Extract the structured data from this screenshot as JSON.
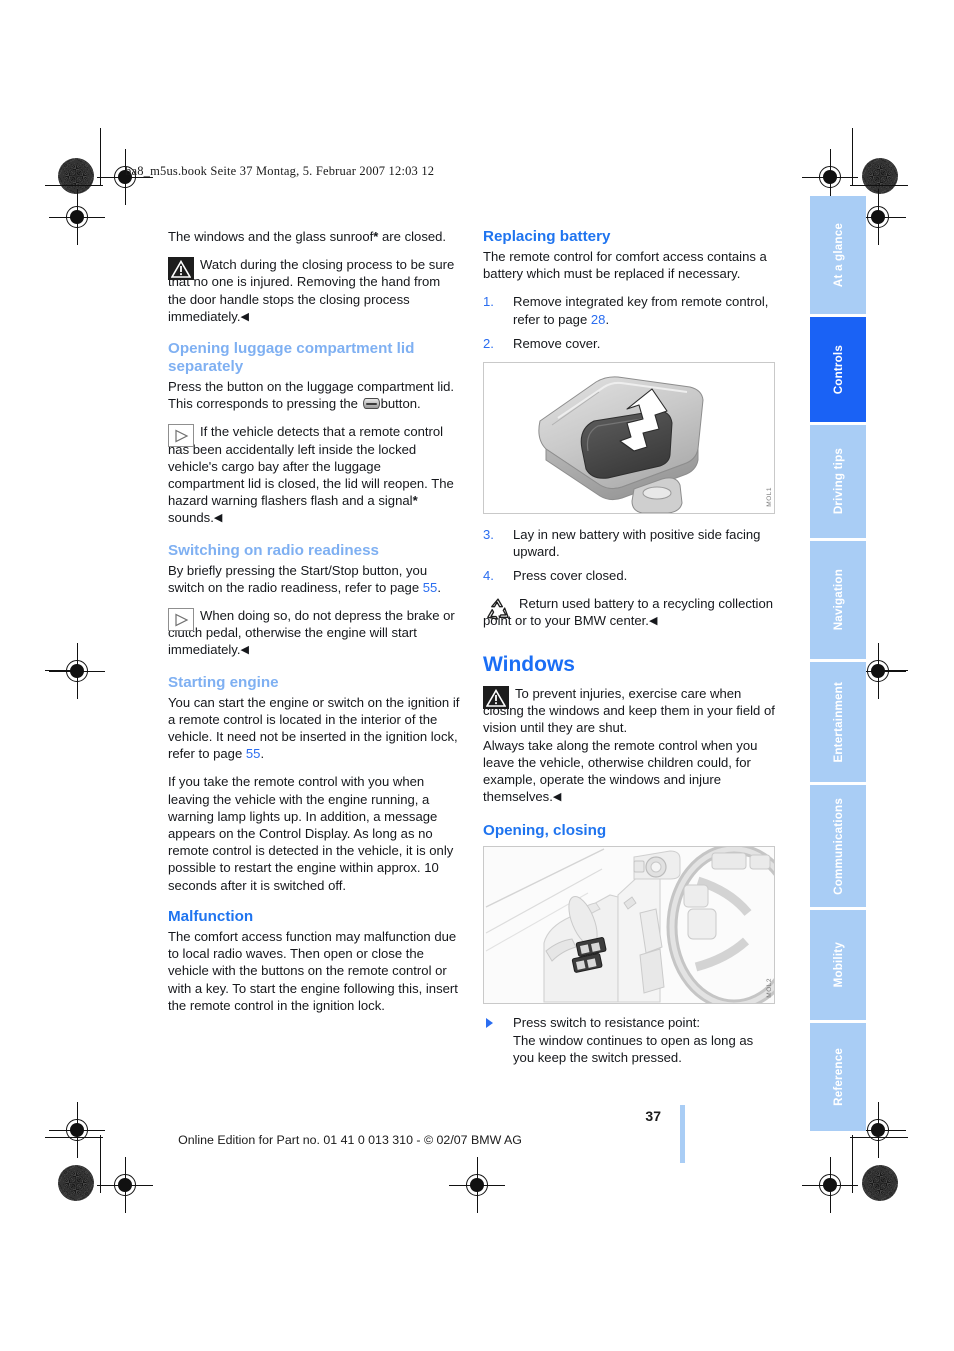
{
  "document": {
    "file_header": "ba8_m5us.book  Seite 37  Montag, 5. Februar 2007  12:03 12",
    "page_number": "37",
    "footer": "Online Edition for Part no. 01 41 0 013 310 - © 02/07 BMW AG"
  },
  "colors": {
    "heading_primary": "#1a6ef5",
    "subheading_light": "#7fb0f2",
    "subheading_dark": "#1f74ef",
    "tab_inactive": "#a9cdf5",
    "tab_active": "#1a62f5",
    "crossref": "#2a6df0",
    "body_text": "#16181c"
  },
  "left_column": {
    "intro": {
      "text": "The windows and the glass sunroof",
      "asterisk": "*",
      "text_tail": " are closed."
    },
    "warning_1": {
      "icon": "warning-triangle-icon",
      "text": "Watch during the closing process to be sure that no one is injured. Removing the hand from the door handle stops the closing process immediately.",
      "end_mark": "◀"
    },
    "section_luggage": {
      "heading": "Opening luggage compartment lid separately",
      "paragraph_a": "Press the button on the luggage compartment lid. This corresponds to pressing the",
      "paragraph_b": "button.",
      "inline_icon": "trunk-release-button-icon",
      "note": {
        "icon": "play-triangle-note-icon",
        "text": "If the vehicle detects that a remote control has been accidentally left inside the locked vehicle's cargo bay after the luggage compartment lid is closed, the lid will reopen. The hazard warning flashers flash and a signal",
        "asterisk": "*",
        "text_tail": " sounds.",
        "end_mark": "◀"
      }
    },
    "section_radio": {
      "heading": "Switching on radio readiness",
      "paragraph_a": "By briefly pressing the Start/Stop button, you switch on the radio readiness, refer to page",
      "page_ref": "55",
      "paragraph_b": ".",
      "note": {
        "icon": "play-triangle-note-icon",
        "text": "When doing so, do not depress the brake or clutch pedal, otherwise the engine will start immediately.",
        "end_mark": "◀"
      }
    },
    "section_starting": {
      "heading": "Starting engine",
      "paragraph_1a": "You can start the engine or switch on the ignition if a remote control is located in the interior of the vehicle. It need not be inserted in the ignition lock, refer to page",
      "page_ref": "55",
      "paragraph_1b": ".",
      "paragraph_2": "If you take the remote control with you when leaving the vehicle with the engine running, a warning lamp lights up. In addition, a message appears on the Control Display. As long as no remote control is detected in the vehicle, it is only possible to restart the engine within approx. 10 seconds after it is switched off."
    },
    "section_malfunction": {
      "heading": "Malfunction",
      "paragraph": "The comfort access function may malfunction due to local radio waves. Then open or close the vehicle with the buttons on the remote control or with a key. To start the engine following this, insert the remote control in the ignition lock."
    }
  },
  "right_column": {
    "section_battery": {
      "heading": "Replacing battery",
      "paragraph": "The remote control for comfort access contains a battery which must be replaced if necessary.",
      "steps_before": [
        {
          "num": "1.",
          "text_a": "Remove integrated key from remote control, refer to page",
          "page_ref": "28",
          "text_b": "."
        },
        {
          "num": "2.",
          "text_a": "Remove cover.",
          "page_ref": "",
          "text_b": ""
        }
      ],
      "figure": {
        "name": "remote-control-cover-removal-illustration",
        "code": "MOL1"
      },
      "steps_after": [
        {
          "num": "3.",
          "text_a": "Lay in new battery with positive side facing upward.",
          "page_ref": "",
          "text_b": ""
        },
        {
          "num": "4.",
          "text_a": "Press cover closed.",
          "page_ref": "",
          "text_b": ""
        }
      ],
      "recycle_note": {
        "icon": "recycling-icon",
        "text": "Return used battery to a recycling collection point or to your BMW center.",
        "end_mark": "◀"
      }
    },
    "section_windows": {
      "heading": "Windows",
      "warning": {
        "icon": "warning-triangle-icon",
        "text": "To prevent injuries, exercise care when closing the windows and keep them in your field of vision until they are shut.",
        "text2": "Always take along the remote control when you leave the vehicle, otherwise children could, for example, operate the windows and injure themselves.",
        "end_mark": "◀"
      },
      "subsection": {
        "heading": "Opening, closing",
        "figure": {
          "name": "door-panel-window-switches-illustration",
          "code": "MOL2"
        },
        "instruction": {
          "bullet": "▷",
          "line1": "Press switch to resistance point:",
          "line2": "The window continues to open as long as you keep the switch pressed."
        }
      }
    }
  },
  "tabs": [
    {
      "label": "At a glance",
      "active": false
    },
    {
      "label": "Controls",
      "active": true
    },
    {
      "label": "Driving tips",
      "active": false
    },
    {
      "label": "Navigation",
      "active": false
    },
    {
      "label": "Entertainment",
      "active": false
    },
    {
      "label": "Communications",
      "active": false
    },
    {
      "label": "Mobility",
      "active": false
    },
    {
      "label": "Reference",
      "active": false
    }
  ]
}
